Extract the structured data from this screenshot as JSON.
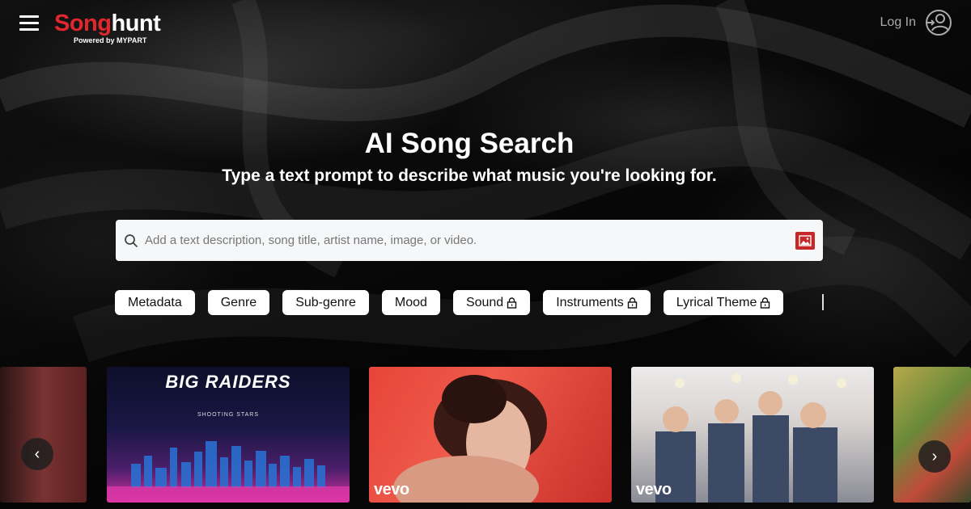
{
  "header": {
    "logo_part1": "Song",
    "logo_part2": "hunt",
    "logo_sub": "Powered by MYPART",
    "login_label": "Log In"
  },
  "hero": {
    "title": "AI Song Search",
    "subtitle": "Type a text prompt to describe what music you're looking for."
  },
  "search": {
    "placeholder": "Add a text description, song title, artist name, image, or video."
  },
  "filters": [
    {
      "label": "Metadata",
      "locked": false
    },
    {
      "label": "Genre",
      "locked": false
    },
    {
      "label": "Sub-genre",
      "locked": false
    },
    {
      "label": "Mood",
      "locked": false
    },
    {
      "label": "Sound",
      "locked": true
    },
    {
      "label": "Instruments",
      "locked": true
    },
    {
      "label": "Lyrical Theme",
      "locked": true
    }
  ],
  "carousel": {
    "cards": [
      {
        "badge": ""
      },
      {
        "title": "BIG RAIDERS",
        "subtitle": "SHOOTING STARS",
        "badge": ""
      },
      {
        "badge": "vevo"
      },
      {
        "badge": "vevo"
      },
      {
        "badge": ""
      }
    ],
    "prev_icon": "‹",
    "next_icon": "›"
  }
}
